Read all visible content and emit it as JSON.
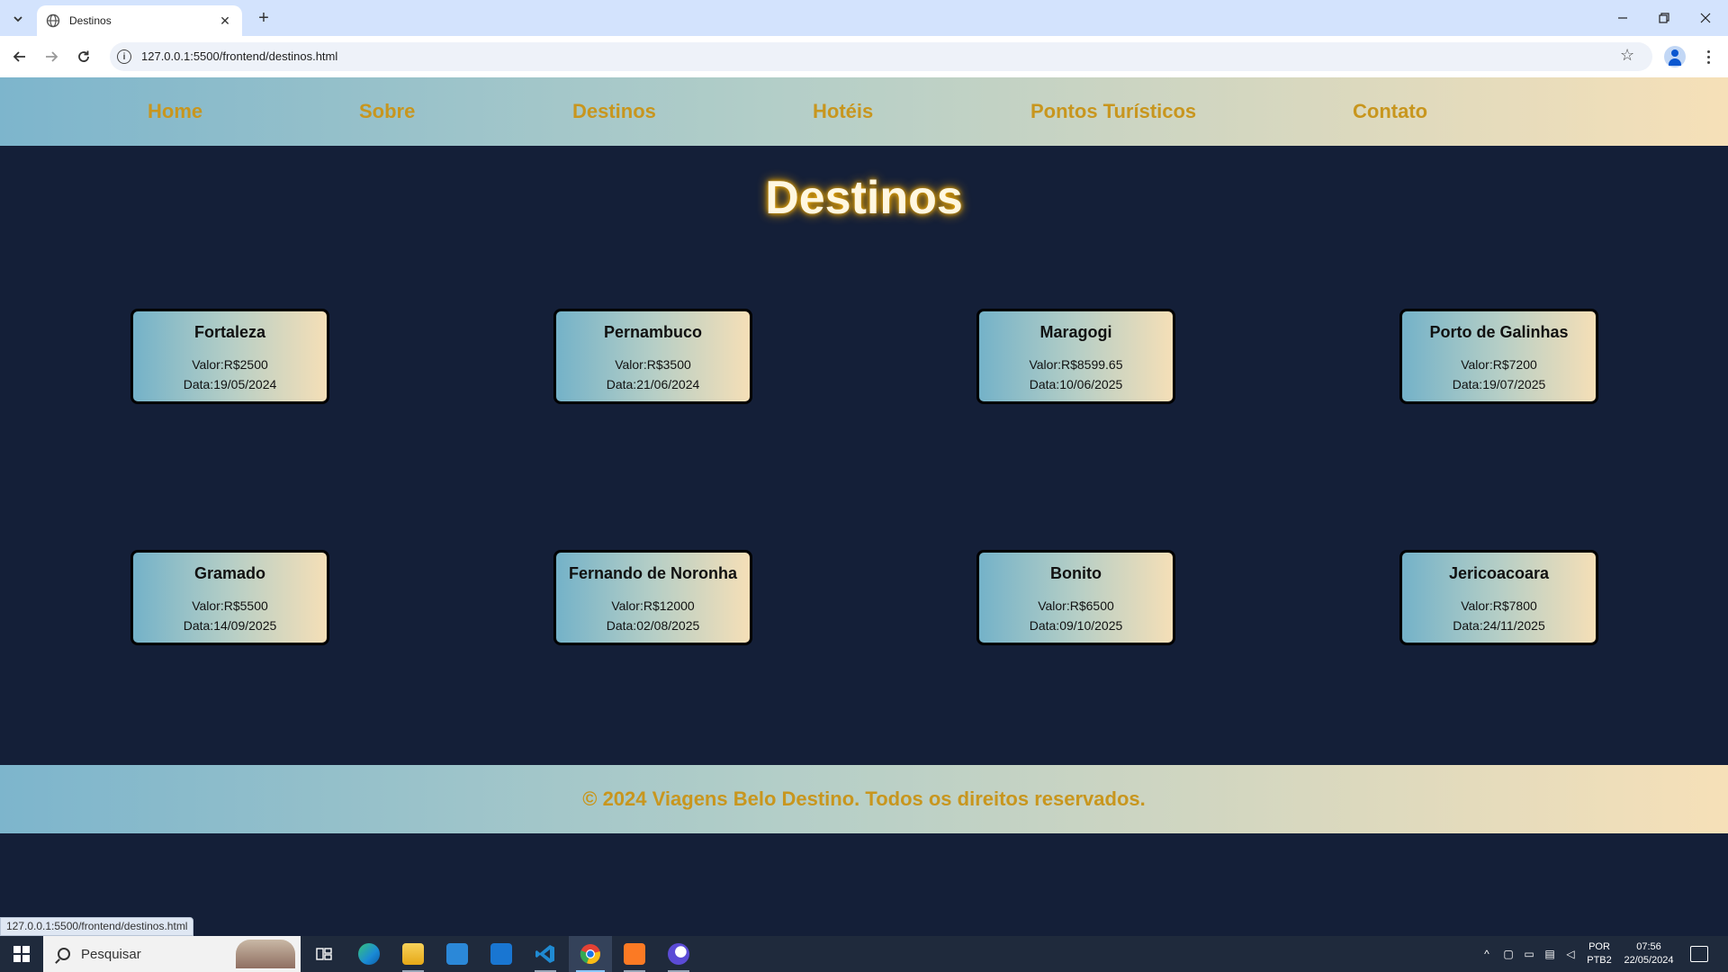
{
  "browser": {
    "tab_title": "Destinos",
    "tab_close": "✕",
    "new_tab": "+",
    "url": "127.0.0.1:5500/frontend/destinos.html",
    "status_url": "127.0.0.1:5500/frontend/destinos.html"
  },
  "nav": {
    "items": [
      {
        "label": "Home"
      },
      {
        "label": "Sobre"
      },
      {
        "label": "Destinos"
      },
      {
        "label": "Hotéis"
      },
      {
        "label": "Pontos Turísticos"
      },
      {
        "label": "Contato"
      }
    ]
  },
  "page": {
    "title": "Destinos"
  },
  "destinations": [
    {
      "name": "Fortaleza",
      "valor": "Valor:R$2500",
      "data": "Data:19/05/2024"
    },
    {
      "name": "Pernambuco",
      "valor": "Valor:R$3500",
      "data": "Data:21/06/2024"
    },
    {
      "name": "Maragogi",
      "valor": "Valor:R$8599.65",
      "data": "Data:10/06/2025"
    },
    {
      "name": "Porto de Galinhas",
      "valor": "Valor:R$7200",
      "data": "Data:19/07/2025"
    },
    {
      "name": "Gramado",
      "valor": "Valor:R$5500",
      "data": "Data:14/09/2025"
    },
    {
      "name": "Fernando de Noronha",
      "valor": "Valor:R$12000",
      "data": "Data:02/08/2025"
    },
    {
      "name": "Bonito",
      "valor": "Valor:R$6500",
      "data": "Data:09/10/2025"
    },
    {
      "name": "Jericoacoara",
      "valor": "Valor:R$7800",
      "data": "Data:24/11/2025"
    }
  ],
  "footer": {
    "text": "© 2024 Viagens Belo Destino. Todos os direitos reservados."
  },
  "taskbar": {
    "search_placeholder": "Pesquisar",
    "language": "POR",
    "layout": "PTB2",
    "time": "07:56",
    "date": "22/05/2024"
  },
  "colors": {
    "page_background": "#141f38",
    "nav_link": "#c8961e",
    "title_glow": "#ffb400",
    "gradient_start": "#7db5cc",
    "gradient_end": "#f6e0b8"
  }
}
